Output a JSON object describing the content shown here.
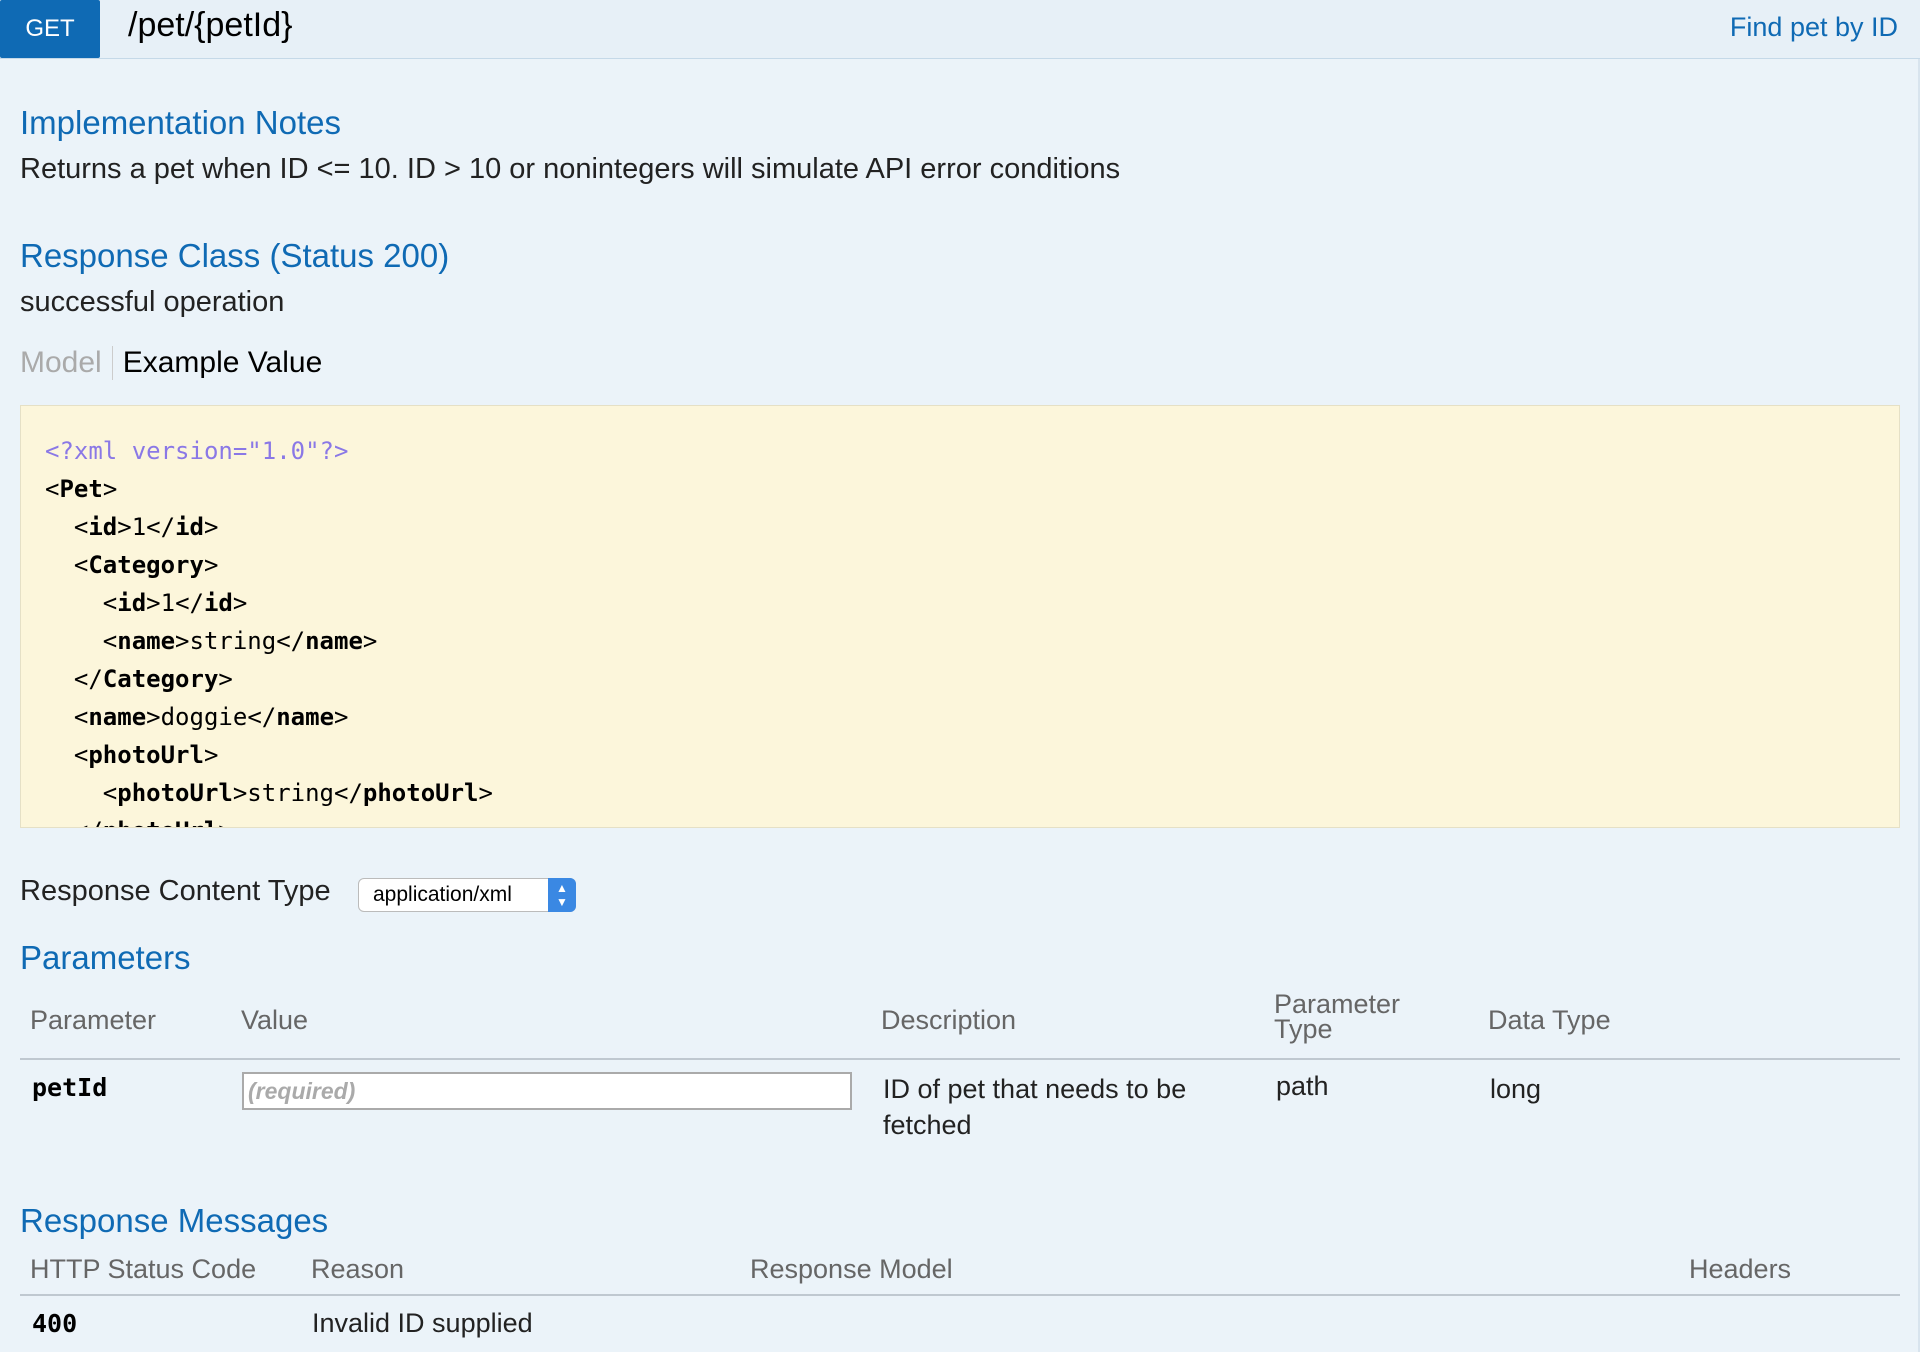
{
  "operation": {
    "method": "GET",
    "path": "/pet/{petId}",
    "summary": "Find pet by ID"
  },
  "implementation_notes": {
    "heading": "Implementation Notes",
    "text": "Returns a pet when ID <= 10. ID > 10 or nonintegers will simulate API error conditions"
  },
  "response_class": {
    "heading": "Response Class (Status 200)",
    "text": "successful operation",
    "tabs": {
      "model": "Model",
      "example": "Example Value"
    }
  },
  "example_xml": {
    "decl": "<?xml version=\"1.0\"?>",
    "lines": [
      {
        "indent": 0,
        "open": "Pet",
        "text": "",
        "close": ""
      },
      {
        "indent": 1,
        "open": "id",
        "text": "1",
        "close": "id"
      },
      {
        "indent": 1,
        "open": "Category",
        "text": "",
        "close": ""
      },
      {
        "indent": 2,
        "open": "id",
        "text": "1",
        "close": "id"
      },
      {
        "indent": 2,
        "open": "name",
        "text": "string",
        "close": "name"
      },
      {
        "indent": 1,
        "open": "",
        "text": "",
        "close": "Category"
      },
      {
        "indent": 1,
        "open": "name",
        "text": "doggie",
        "close": "name"
      },
      {
        "indent": 1,
        "open": "photoUrl",
        "text": "",
        "close": ""
      },
      {
        "indent": 2,
        "open": "photoUrl",
        "text": "string",
        "close": "photoUrl"
      },
      {
        "indent": 1,
        "open": "",
        "text": "",
        "close": "photoUrl"
      }
    ]
  },
  "response_content_type": {
    "label": "Response Content Type",
    "selected": "application/xml"
  },
  "parameters": {
    "heading": "Parameters",
    "columns": [
      "Parameter",
      "Value",
      "Description",
      "Parameter\nType",
      "Data Type"
    ],
    "rows": [
      {
        "name": "petId",
        "placeholder": "(required)",
        "description": "ID of pet that needs to be fetched",
        "param_type": "path",
        "data_type": "long"
      }
    ]
  },
  "response_messages": {
    "heading": "Response Messages",
    "columns": [
      "HTTP Status Code",
      "Reason",
      "Response Model",
      "Headers"
    ],
    "rows": [
      {
        "code": "400",
        "reason": "Invalid ID supplied"
      }
    ]
  }
}
